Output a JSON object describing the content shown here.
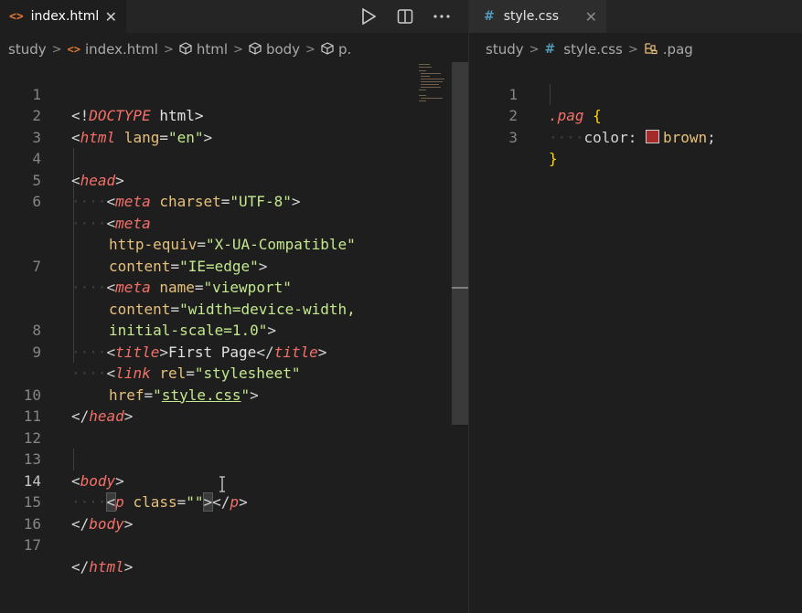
{
  "left": {
    "tab": {
      "label": "index.html",
      "icon": "html-file-icon"
    },
    "actions": [
      "run-icon",
      "split-editor-icon",
      "more-icon"
    ],
    "breadcrumb": [
      "study",
      "index.html",
      "html",
      "body",
      "p."
    ],
    "lines": [
      {
        "n": "1"
      },
      {
        "n": "2"
      },
      {
        "n": "3"
      },
      {
        "n": "4"
      },
      {
        "n": "5"
      },
      {
        "n": "6"
      },
      {
        "n": ""
      },
      {
        "n": ""
      },
      {
        "n": "7"
      },
      {
        "n": ""
      },
      {
        "n": ""
      },
      {
        "n": "8"
      },
      {
        "n": "9"
      },
      {
        "n": ""
      },
      {
        "n": "10"
      },
      {
        "n": "11"
      },
      {
        "n": "12"
      },
      {
        "n": "13"
      },
      {
        "n": "14"
      },
      {
        "n": "15"
      },
      {
        "n": "16"
      },
      {
        "n": "17"
      }
    ],
    "code": {
      "l1a": "<!",
      "l1b": "DOCTYPE",
      "l1c": " html>",
      "l2a": "<",
      "l2b": "html",
      "l2c": " lang",
      "l2d": "=",
      "l2e": "\"en\"",
      "l2f": ">",
      "l4a": "<",
      "l4b": "head",
      "l4c": ">",
      "ind": "····",
      "l5a": "<",
      "l5b": "meta",
      "l5c": " charset",
      "l5d": "=",
      "l5e": "\"UTF-8\"",
      "l5f": ">",
      "l6a": "<",
      "l6b": "meta",
      "l6c": "http-equiv",
      "l6d": "=",
      "l6e": "\"X-UA-Compatible\"",
      "l6f": "content",
      "l6g": "=",
      "l6h": "\"IE=edge\"",
      "l6i": ">",
      "l7a": "<",
      "l7b": "meta",
      "l7c": " name",
      "l7d": "=",
      "l7e": "\"viewport\"",
      "l7f": "content",
      "l7g": "=",
      "l7h": "\"width=device-width,",
      "l7i": "initial-scale=1.0\"",
      "l7j": ">",
      "l8a": "<",
      "l8b": "title",
      "l8c": ">",
      "l8d": "First Page",
      "l8e": "</",
      "l8f": "title",
      "l8g": ">",
      "l9a": "<",
      "l9b": "link",
      "l9c": " rel",
      "l9d": "=",
      "l9e": "\"stylesheet\"",
      "l9f": "href",
      "l9g": "=",
      "l9h": "\"",
      "l9i": "style.css",
      "l9j": "\"",
      "l9k": ">",
      "l10a": "</",
      "l10b": "head",
      "l10c": ">",
      "l13a": "<",
      "l13b": "body",
      "l13c": ">",
      "l14a": "<",
      "l14b": "p",
      "l14c": " class",
      "l14d": "=",
      "l14e": "\"\"",
      "l14f": ">",
      "l14g": "</",
      "l14h": "p",
      "l14i": ">",
      "l15a": "</",
      "l15b": "body",
      "l15c": ">",
      "l17a": "</",
      "l17b": "html",
      "l17c": ">"
    }
  },
  "right": {
    "tab": {
      "label": "style.css",
      "icon": "css-file-icon"
    },
    "breadcrumb": [
      "study",
      "style.css",
      ".pag"
    ],
    "lines": [
      {
        "n": "1"
      },
      {
        "n": "2"
      },
      {
        "n": "3"
      }
    ],
    "code": {
      "r1a": ".pag",
      "r1b": " {",
      "ind": "····",
      "r2a": "color",
      "r2b": ": ",
      "r2c": "brown",
      "r2d": ";",
      "r3a": "}"
    },
    "colors": {
      "swatch": "#a52a2a"
    }
  }
}
